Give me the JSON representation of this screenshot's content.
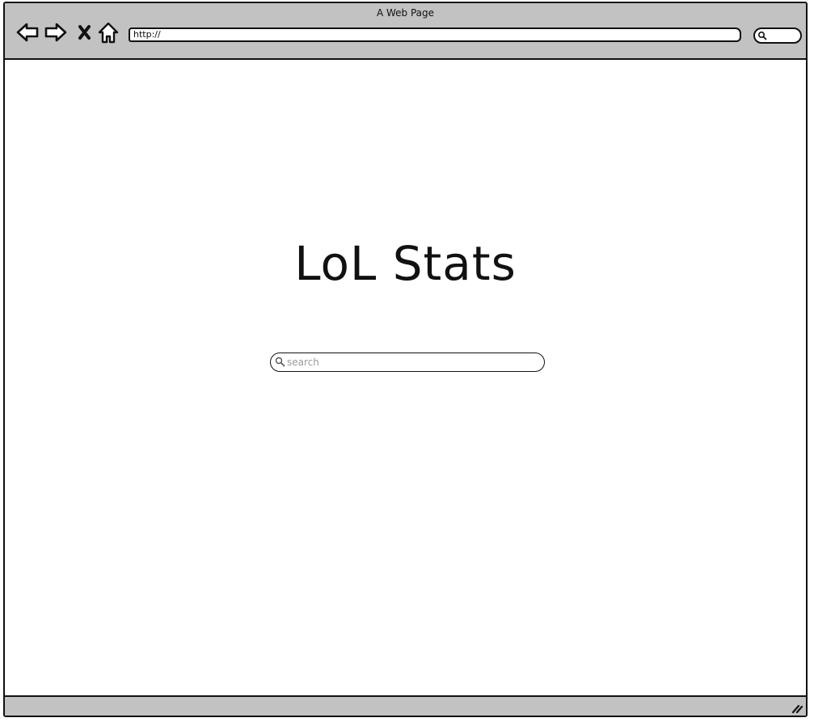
{
  "window": {
    "title": "A Web Page"
  },
  "toolbar": {
    "back_icon": "back-arrow-icon",
    "forward_icon": "forward-arrow-icon",
    "stop_icon": "close-icon",
    "home_icon": "home-icon",
    "url_value": "http://",
    "search_icon": "search-icon"
  },
  "main": {
    "title": "LoL Stats",
    "search": {
      "placeholder": "search",
      "value": "",
      "icon": "search-icon"
    }
  },
  "colors": {
    "chrome": "#c2c2c2",
    "border": "#111111",
    "background": "#ffffff",
    "placeholder": "#9a9a9a"
  }
}
